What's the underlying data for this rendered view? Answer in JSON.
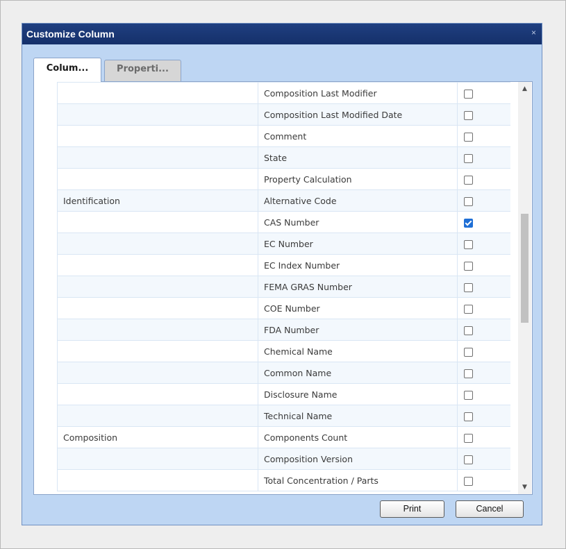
{
  "dialog": {
    "title": "Customize Column",
    "close_symbol": "×",
    "tabs": [
      {
        "label": "Colum...",
        "active": true
      },
      {
        "label": "Properti...",
        "active": false
      }
    ],
    "rows": [
      {
        "group": "",
        "field": "Composition Last Modifier",
        "checked": false
      },
      {
        "group": "",
        "field": "Composition Last Modified Date",
        "checked": false
      },
      {
        "group": "",
        "field": "Comment",
        "checked": false
      },
      {
        "group": "",
        "field": "State",
        "checked": false
      },
      {
        "group": "",
        "field": "Property Calculation",
        "checked": false
      },
      {
        "group": "Identification",
        "field": "Alternative Code",
        "checked": false
      },
      {
        "group": "",
        "field": "CAS Number",
        "checked": true
      },
      {
        "group": "",
        "field": "EC Number",
        "checked": false
      },
      {
        "group": "",
        "field": "EC Index Number",
        "checked": false
      },
      {
        "group": "",
        "field": "FEMA GRAS Number",
        "checked": false
      },
      {
        "group": "",
        "field": "COE Number",
        "checked": false
      },
      {
        "group": "",
        "field": "FDA Number",
        "checked": false
      },
      {
        "group": "",
        "field": "Chemical Name",
        "checked": false
      },
      {
        "group": "",
        "field": "Common Name",
        "checked": false
      },
      {
        "group": "",
        "field": "Disclosure Name",
        "checked": false
      },
      {
        "group": "",
        "field": "Technical Name",
        "checked": false
      },
      {
        "group": "Composition",
        "field": "Components Count",
        "checked": false
      },
      {
        "group": "",
        "field": "Composition Version",
        "checked": false
      },
      {
        "group": "",
        "field": "Total Concentration / Parts",
        "checked": false
      }
    ],
    "buttons": {
      "print_label": "Print",
      "cancel_label": "Cancel"
    },
    "scrollbar": {
      "up_icon": "▲",
      "down_icon": "▼"
    }
  }
}
